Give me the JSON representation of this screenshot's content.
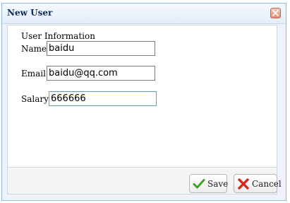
{
  "dialog": {
    "title": "New User",
    "close_icon": "close-icon"
  },
  "form": {
    "section_title": "User Information",
    "fields": {
      "name": {
        "label": "Name:",
        "value": "baidu"
      },
      "email": {
        "label": "Email:",
        "value": "baidu@qq.com"
      },
      "salary": {
        "label": "Salary:",
        "value": "666666"
      }
    }
  },
  "footer": {
    "save": {
      "label": "Save",
      "icon": "checkmark-icon"
    },
    "cancel": {
      "label": "Cancel",
      "icon": "cross-icon"
    }
  },
  "colors": {
    "title_text": "#0e2d5f",
    "window_border": "#95b8e7",
    "focus_border": "#5b9fdf",
    "save_icon": "#3aa51f",
    "cancel_icon": "#d7281e"
  }
}
